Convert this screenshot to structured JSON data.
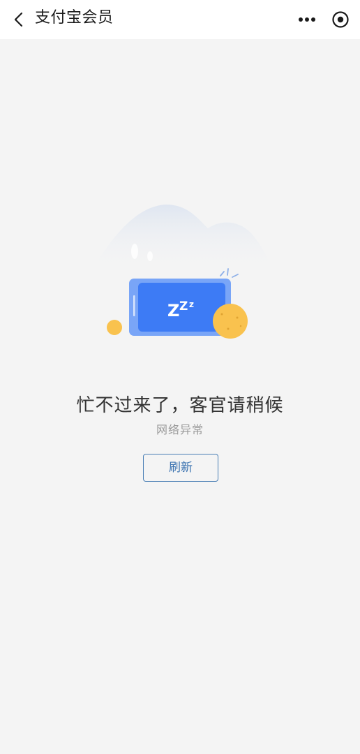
{
  "header": {
    "title": "支付宝会员",
    "back_icon": "chevron-left-icon",
    "more_icon": "more-dots-icon",
    "target_icon": "target-circle-icon"
  },
  "illustration": {
    "sleep_text": "ZZZ",
    "phone_color": "#3d7bf5",
    "coin_color": "#f9c24e"
  },
  "error": {
    "title": "忙不过来了，客官请稍候",
    "subtitle": "网络异常"
  },
  "actions": {
    "refresh_label": "刷新"
  },
  "colors": {
    "background": "#f4f4f4",
    "accent": "#3a72b0"
  }
}
